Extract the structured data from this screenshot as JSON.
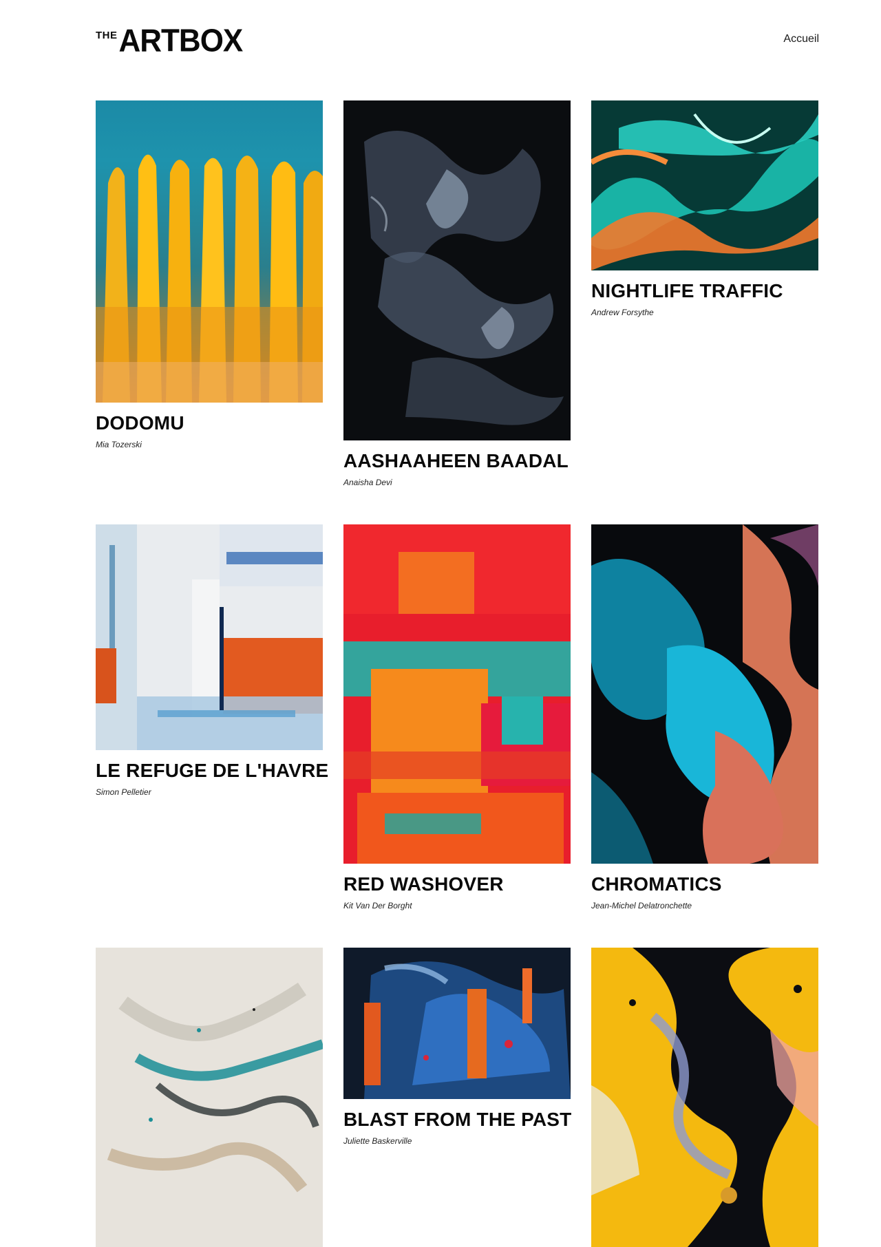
{
  "header": {
    "logo_small": "THE",
    "logo_big": "ARTBOX",
    "nav_link": "Accueil"
  },
  "artworks": [
    {
      "title": "DODOMU",
      "artist": "Mia Tozerski"
    },
    {
      "title": "AASHAAHEEN BAADAL",
      "artist": "Anaisha Devi"
    },
    {
      "title": "NIGHTLIFE TRAFFIC",
      "artist": "Andrew Forsythe"
    },
    {
      "title": "LE REFUGE DE L'HAVRE",
      "artist": "Simon Pelletier"
    },
    {
      "title": "RED WASHOVER",
      "artist": "Kit Van Der Borght"
    },
    {
      "title": "CHROMATICS",
      "artist": "Jean-Michel Delatronchette"
    },
    {
      "title": "",
      "artist": ""
    },
    {
      "title": "BLAST FROM THE PAST",
      "artist": "Juliette Baskerville"
    },
    {
      "title": "",
      "artist": ""
    }
  ],
  "colors": {
    "text": "#0a0a0a",
    "background": "#ffffff"
  }
}
